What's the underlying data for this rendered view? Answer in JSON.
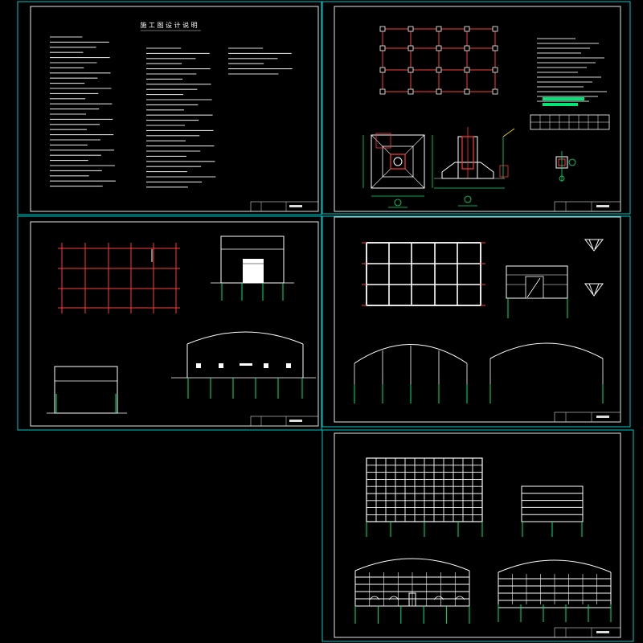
{
  "notes_sheet": {
    "title": "施 工 图 设 计 说 明"
  }
}
